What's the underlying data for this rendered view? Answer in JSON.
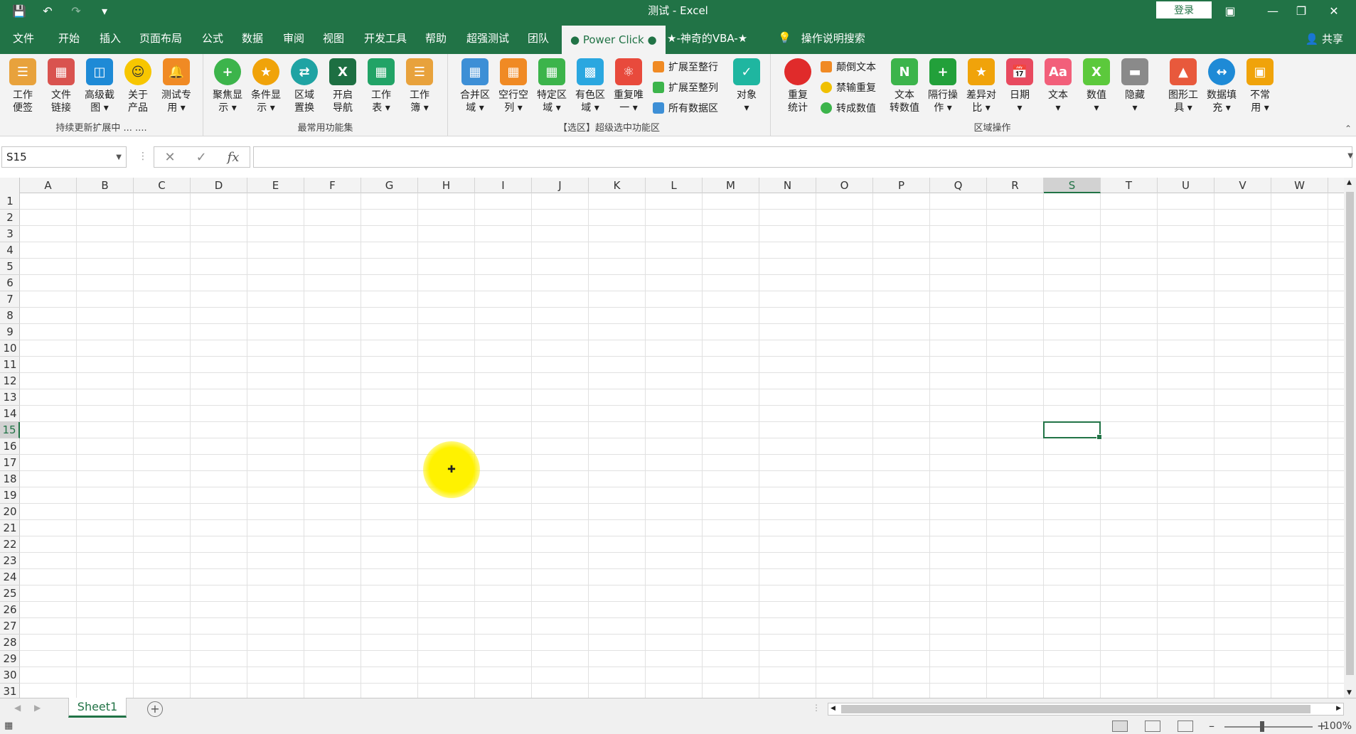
{
  "window": {
    "title": "测试  -  Excel",
    "login_label": "登录",
    "share_label": "共享"
  },
  "tabs": [
    "文件",
    "开始",
    "插入",
    "页面布局",
    "公式",
    "数据",
    "审阅",
    "视图",
    "开发工具",
    "帮助",
    "超强测试",
    "团队",
    "● Power Click ●",
    "★-神奇的VBA-★",
    "操作说明搜索"
  ],
  "active_tab": "● Power Click ●",
  "ribbon": {
    "group1": {
      "label": "持续更新扩展中 ... ....",
      "buttons": [
        "工作\n便签",
        "文件\n链接",
        "高级截\n图 ▾",
        "关于\n产品",
        "测试专\n用 ▾"
      ]
    },
    "group2": {
      "label": "最常用功能集",
      "buttons": [
        "聚焦显\n示 ▾",
        "条件显\n示 ▾",
        "区域\n置换",
        "开启\n导航",
        "工作\n表 ▾",
        "工作\n簿 ▾"
      ]
    },
    "group3": {
      "label": "【选区】超级选中功能区",
      "buttons": [
        "合并区\n域 ▾",
        "空行空\n列 ▾",
        "特定区\n域 ▾",
        "有色区\n域 ▾",
        "重复唯\n一 ▾"
      ],
      "small": [
        "扩展至整行",
        "扩展至整列",
        "所有数据区"
      ],
      "last": "对象\n▾"
    },
    "group4": {
      "label": "区域操作",
      "first": "重复\n统计",
      "small": [
        "颠倒文本",
        "禁输重复",
        "转成数值"
      ],
      "buttons": [
        "文本\n转数值",
        "隔行操\n作 ▾",
        "差异对\n比 ▾",
        "日期\n▾",
        "文本\n▾",
        "数值\n▾",
        "隐藏\n▾",
        "图形工\n具 ▾",
        "数据填\n充 ▾",
        "不常\n用 ▾"
      ]
    }
  },
  "formula_bar": {
    "name_box": "S15",
    "cancel": "✕",
    "enter": "✓",
    "fx": "fx",
    "value": ""
  },
  "grid": {
    "columns": [
      "A",
      "B",
      "C",
      "D",
      "E",
      "F",
      "G",
      "H",
      "I",
      "J",
      "K",
      "L",
      "M",
      "N",
      "O",
      "P",
      "Q",
      "R",
      "S",
      "T",
      "U",
      "V",
      "W"
    ],
    "rows": [
      "1",
      "2",
      "3",
      "4",
      "5",
      "6",
      "7",
      "8",
      "9",
      "10",
      "11",
      "12",
      "13",
      "14",
      "15",
      "16",
      "17",
      "18",
      "19",
      "20",
      "21",
      "22",
      "23",
      "24",
      "25",
      "26",
      "27",
      "28",
      "29",
      "30",
      "31"
    ],
    "selected_column": "S",
    "selected_row": "15"
  },
  "sheets": [
    "Sheet1"
  ],
  "status": {
    "zoom": "100%"
  },
  "colors": {
    "brand": "#217346",
    "ribbon_bg": "#f3f3f3"
  }
}
